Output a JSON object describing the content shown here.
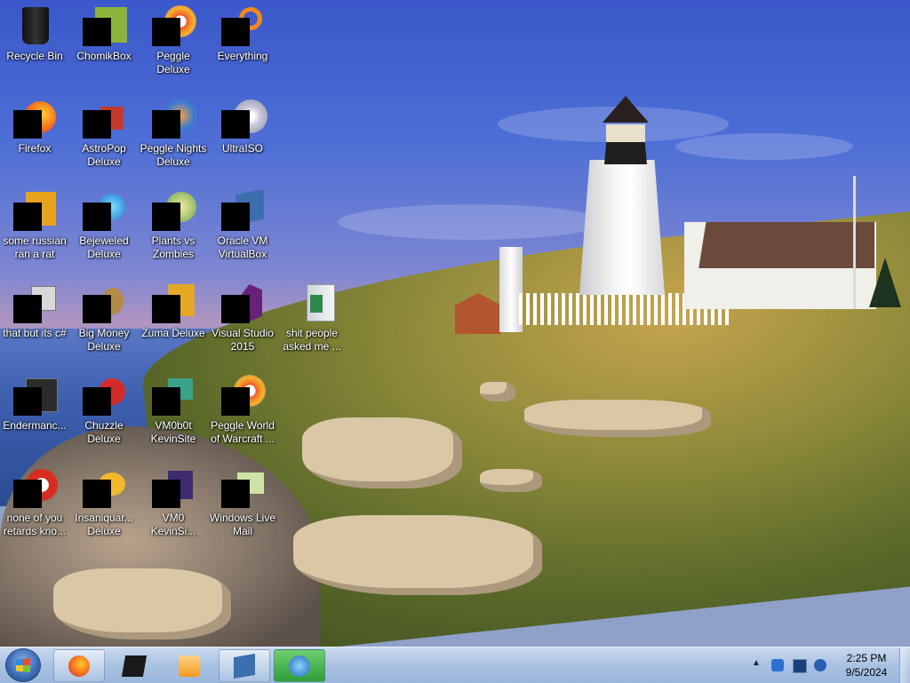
{
  "desktop": {
    "icons": [
      {
        "label": "Recycle Bin",
        "icon": "recycle-bin-icon"
      },
      {
        "label": "ChomikBox",
        "icon": "chomikbox-icon"
      },
      {
        "label": "Peggle Deluxe",
        "icon": "peggle-icon"
      },
      {
        "label": "Everything",
        "icon": "everything-search-icon"
      },
      {
        "label": "Firefox",
        "icon": "firefox-icon"
      },
      {
        "label": "AstroPop Deluxe",
        "icon": "astropop-icon"
      },
      {
        "label": "Peggle Nights Deluxe",
        "icon": "peggle-nights-icon"
      },
      {
        "label": "UltraISO",
        "icon": "ultraiso-icon"
      },
      {
        "label": "some russian ran a rat",
        "icon": "app-icon"
      },
      {
        "label": "Bejeweled Deluxe",
        "icon": "bejeweled-icon"
      },
      {
        "label": "Plants vs Zombies",
        "icon": "plants-vs-zombies-icon"
      },
      {
        "label": "Oracle VM VirtualBox",
        "icon": "virtualbox-icon"
      },
      {
        "label": "that but its c#",
        "icon": "shortcut-icon"
      },
      {
        "label": "Big Money Deluxe",
        "icon": "big-money-icon"
      },
      {
        "label": "Zuma Deluxe",
        "icon": "zuma-icon"
      },
      {
        "label": "Visual Studio 2015",
        "icon": "visual-studio-icon"
      },
      {
        "label": "shit people asked me ...",
        "icon": "folder-icon"
      },
      {
        "label": "Endermanc...",
        "icon": "terminal-icon"
      },
      {
        "label": "Chuzzle Deluxe",
        "icon": "chuzzle-icon"
      },
      {
        "label": "VM0b0t KevinSite",
        "icon": "vm-icon"
      },
      {
        "label": "Peggle World of Warcraft ...",
        "icon": "peggle-wow-icon"
      },
      {
        "label": "none of you retards kno...",
        "icon": "app-icon"
      },
      {
        "label": "Insaniquar... Deluxe",
        "icon": "insaniquarium-icon"
      },
      {
        "label": "VM0 KevinSi...",
        "icon": "vm-icon"
      },
      {
        "label": "Windows Live Mail",
        "icon": "windows-live-mail-icon"
      }
    ]
  },
  "taskbar": {
    "start": "windows-start-orb",
    "pinned": [
      {
        "name": "firefox",
        "icon": "firefox-icon",
        "active": true
      },
      {
        "name": "cmd",
        "icon": "command-prompt-icon",
        "active": false
      },
      {
        "name": "media-player",
        "icon": "media-player-icon",
        "active": false
      },
      {
        "name": "virtualbox",
        "icon": "virtualbox-icon",
        "active": true
      },
      {
        "name": "internet-download-manager",
        "icon": "download-manager-icon",
        "active": true
      }
    ],
    "tray": {
      "chevron": "show-hidden-icons",
      "icons": [
        "bluetooth-icon",
        "network-icon",
        "volume-icon"
      ],
      "time": "2:25 PM",
      "date": "9/5/2024"
    }
  }
}
